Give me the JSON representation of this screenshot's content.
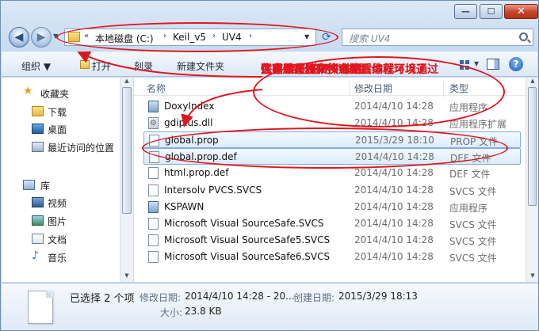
{
  "window_controls": {
    "minimize": "—",
    "maximize": "☐",
    "close": "✕"
  },
  "nav": {
    "back_glyph": "◀",
    "forward_glyph": "▶",
    "dropdown_glyph": "▼"
  },
  "address": {
    "prefix": "«",
    "segments": [
      "本地磁盘 (C:)",
      "Keil_v5",
      "UV4"
    ],
    "separator": "›",
    "dropdown_glyph": "▼",
    "refresh_glyph": "⟳"
  },
  "search": {
    "placeholder": "搜索 UV4"
  },
  "toolbar": {
    "organize": "组织 ▼",
    "open": "打开",
    "burn": "刻录",
    "new_folder": "新建文件夹",
    "help": "?"
  },
  "sidebar": {
    "items": [
      {
        "label": "收藏夹",
        "icon": "star-icon"
      },
      {
        "label": "下载",
        "icon": "folder-icon"
      },
      {
        "label": "桌面",
        "icon": "desktop-icon"
      },
      {
        "label": "最近访问的位置",
        "icon": "recent-places-icon"
      },
      {
        "label": "库",
        "icon": "library-icon"
      },
      {
        "label": "视频",
        "icon": "video-icon"
      },
      {
        "label": "图片",
        "icon": "picture-icon"
      },
      {
        "label": "文档",
        "icon": "document-icon"
      },
      {
        "label": "音乐",
        "icon": "music-icon"
      }
    ]
  },
  "columns": {
    "name": "名称",
    "date": "修改日期",
    "type": "类型"
  },
  "files": [
    {
      "name": "DoxyIndex",
      "date": "2014/4/10 14:28",
      "type": "应用程序",
      "icon": "app-icon",
      "selected": false
    },
    {
      "name": "gdiplus.dll",
      "date": "2014/4/10 14:28",
      "type": "应用程序扩展",
      "icon": "dll-icon",
      "selected": false
    },
    {
      "name": "global.prop",
      "date": "2015/3/29 18:10",
      "type": "PROP 文件",
      "icon": "file-icon",
      "selected": true
    },
    {
      "name": "global.prop.def",
      "date": "2014/4/10 14:28",
      "type": "DEF 文件",
      "icon": "file-icon",
      "selected": true
    },
    {
      "name": "html.prop.def",
      "date": "2014/4/10 14:28",
      "type": "DEF 文件",
      "icon": "file-icon",
      "selected": false
    },
    {
      "name": "Intersolv PVCS.SVCS",
      "date": "2014/4/10 14:28",
      "type": "SVCS 文件",
      "icon": "file-icon",
      "selected": false
    },
    {
      "name": "KSPAWN",
      "date": "2014/4/10 14:28",
      "type": "应用程序",
      "icon": "app-icon",
      "selected": false
    },
    {
      "name": "Microsoft Visual SourceSafe.SVCS",
      "date": "2014/4/10 14:28",
      "type": "SVCS 文件",
      "icon": "file-icon",
      "selected": false
    },
    {
      "name": "Microsoft Visual SourceSafe5.SVCS",
      "date": "2014/4/10 14:28",
      "type": "SVCS 文件",
      "icon": "file-icon",
      "selected": false
    },
    {
      "name": "Microsoft Visual SourceSafe6.SVCS",
      "date": "2014/4/10 14:28",
      "type": "SVCS 文件",
      "icon": "file-icon",
      "selected": false
    }
  ],
  "details": {
    "selection": "已选择 2 个项",
    "modified_label": "修改日期:",
    "modified_value": "2014/4/10 14:28 - 20...",
    "created_label": "创建日期:",
    "created_value": "2015/3/29 18:13",
    "size_label": "大小:",
    "size_value": "23.8 KB"
  },
  "annotation": {
    "lines": [
      "注意路径和文件名称",
      "保存/备份这两个文件",
      "在重装系统和换电脑后你就可以通过",
      "这两个文件来快速配置编程环境了"
    ],
    "color": "#e0161e"
  }
}
